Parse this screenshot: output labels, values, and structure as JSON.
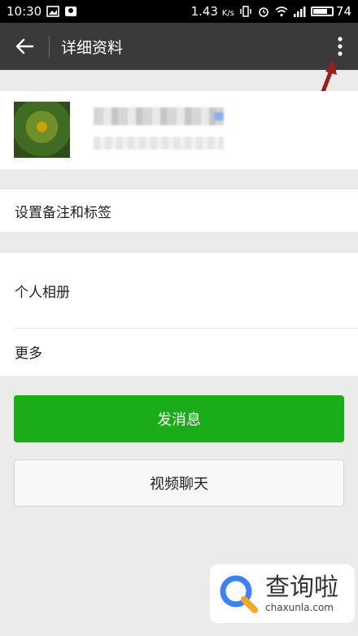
{
  "status_bar": {
    "time": "10:30",
    "speed": "1.43",
    "speed_unit": "K/s",
    "battery": "74"
  },
  "header": {
    "title": "详细资料"
  },
  "profile": {
    "name": "",
    "id_label": ""
  },
  "rows": {
    "remark_tags": "设置备注和标签",
    "album": "个人相册",
    "more": "更多"
  },
  "buttons": {
    "send_message": "发消息",
    "video_chat": "视频聊天"
  },
  "watermark": {
    "cn": "查询啦",
    "en": "chaxunla.com"
  },
  "colors": {
    "title_bar": "#3a3a3c",
    "primary_green": "#1aad19",
    "annotation_arrow": "#9b1c1c"
  }
}
